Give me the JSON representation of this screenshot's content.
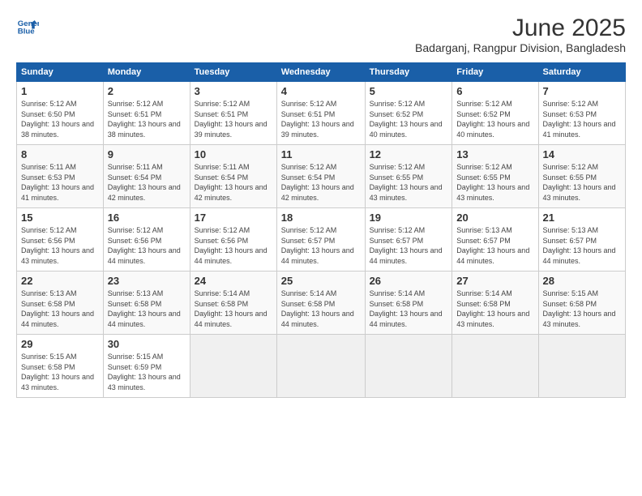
{
  "header": {
    "logo_line1": "General",
    "logo_line2": "Blue",
    "title": "June 2025",
    "subtitle": "Badarganj, Rangpur Division, Bangladesh"
  },
  "calendar": {
    "days_of_week": [
      "Sunday",
      "Monday",
      "Tuesday",
      "Wednesday",
      "Thursday",
      "Friday",
      "Saturday"
    ],
    "weeks": [
      [
        null,
        {
          "day": "2",
          "sunrise": "5:12 AM",
          "sunset": "6:51 PM",
          "daylight": "13 hours and 38 minutes."
        },
        {
          "day": "3",
          "sunrise": "5:12 AM",
          "sunset": "6:51 PM",
          "daylight": "13 hours and 39 minutes."
        },
        {
          "day": "4",
          "sunrise": "5:12 AM",
          "sunset": "6:51 PM",
          "daylight": "13 hours and 39 minutes."
        },
        {
          "day": "5",
          "sunrise": "5:12 AM",
          "sunset": "6:52 PM",
          "daylight": "13 hours and 40 minutes."
        },
        {
          "day": "6",
          "sunrise": "5:12 AM",
          "sunset": "6:52 PM",
          "daylight": "13 hours and 40 minutes."
        },
        {
          "day": "7",
          "sunrise": "5:12 AM",
          "sunset": "6:53 PM",
          "daylight": "13 hours and 41 minutes."
        }
      ],
      [
        {
          "day": "1",
          "sunrise": "5:12 AM",
          "sunset": "6:50 PM",
          "daylight": "13 hours and 38 minutes."
        },
        {
          "day": "9",
          "sunrise": "5:11 AM",
          "sunset": "6:54 PM",
          "daylight": "13 hours and 42 minutes."
        },
        {
          "day": "10",
          "sunrise": "5:11 AM",
          "sunset": "6:54 PM",
          "daylight": "13 hours and 42 minutes."
        },
        {
          "day": "11",
          "sunrise": "5:12 AM",
          "sunset": "6:54 PM",
          "daylight": "13 hours and 42 minutes."
        },
        {
          "day": "12",
          "sunrise": "5:12 AM",
          "sunset": "6:55 PM",
          "daylight": "13 hours and 43 minutes."
        },
        {
          "day": "13",
          "sunrise": "5:12 AM",
          "sunset": "6:55 PM",
          "daylight": "13 hours and 43 minutes."
        },
        {
          "day": "14",
          "sunrise": "5:12 AM",
          "sunset": "6:55 PM",
          "daylight": "13 hours and 43 minutes."
        }
      ],
      [
        {
          "day": "8",
          "sunrise": "5:11 AM",
          "sunset": "6:53 PM",
          "daylight": "13 hours and 41 minutes."
        },
        {
          "day": "16",
          "sunrise": "5:12 AM",
          "sunset": "6:56 PM",
          "daylight": "13 hours and 44 minutes."
        },
        {
          "day": "17",
          "sunrise": "5:12 AM",
          "sunset": "6:56 PM",
          "daylight": "13 hours and 44 minutes."
        },
        {
          "day": "18",
          "sunrise": "5:12 AM",
          "sunset": "6:57 PM",
          "daylight": "13 hours and 44 minutes."
        },
        {
          "day": "19",
          "sunrise": "5:12 AM",
          "sunset": "6:57 PM",
          "daylight": "13 hours and 44 minutes."
        },
        {
          "day": "20",
          "sunrise": "5:13 AM",
          "sunset": "6:57 PM",
          "daylight": "13 hours and 44 minutes."
        },
        {
          "day": "21",
          "sunrise": "5:13 AM",
          "sunset": "6:57 PM",
          "daylight": "13 hours and 44 minutes."
        }
      ],
      [
        {
          "day": "15",
          "sunrise": "5:12 AM",
          "sunset": "6:56 PM",
          "daylight": "13 hours and 43 minutes."
        },
        {
          "day": "23",
          "sunrise": "5:13 AM",
          "sunset": "6:58 PM",
          "daylight": "13 hours and 44 minutes."
        },
        {
          "day": "24",
          "sunrise": "5:14 AM",
          "sunset": "6:58 PM",
          "daylight": "13 hours and 44 minutes."
        },
        {
          "day": "25",
          "sunrise": "5:14 AM",
          "sunset": "6:58 PM",
          "daylight": "13 hours and 44 minutes."
        },
        {
          "day": "26",
          "sunrise": "5:14 AM",
          "sunset": "6:58 PM",
          "daylight": "13 hours and 44 minutes."
        },
        {
          "day": "27",
          "sunrise": "5:14 AM",
          "sunset": "6:58 PM",
          "daylight": "13 hours and 43 minutes."
        },
        {
          "day": "28",
          "sunrise": "5:15 AM",
          "sunset": "6:58 PM",
          "daylight": "13 hours and 43 minutes."
        }
      ],
      [
        {
          "day": "22",
          "sunrise": "5:13 AM",
          "sunset": "6:58 PM",
          "daylight": "13 hours and 44 minutes."
        },
        {
          "day": "30",
          "sunrise": "5:15 AM",
          "sunset": "6:59 PM",
          "daylight": "13 hours and 43 minutes."
        },
        null,
        null,
        null,
        null,
        null
      ],
      [
        {
          "day": "29",
          "sunrise": "5:15 AM",
          "sunset": "6:58 PM",
          "daylight": "13 hours and 43 minutes."
        },
        null,
        null,
        null,
        null,
        null,
        null
      ]
    ]
  }
}
